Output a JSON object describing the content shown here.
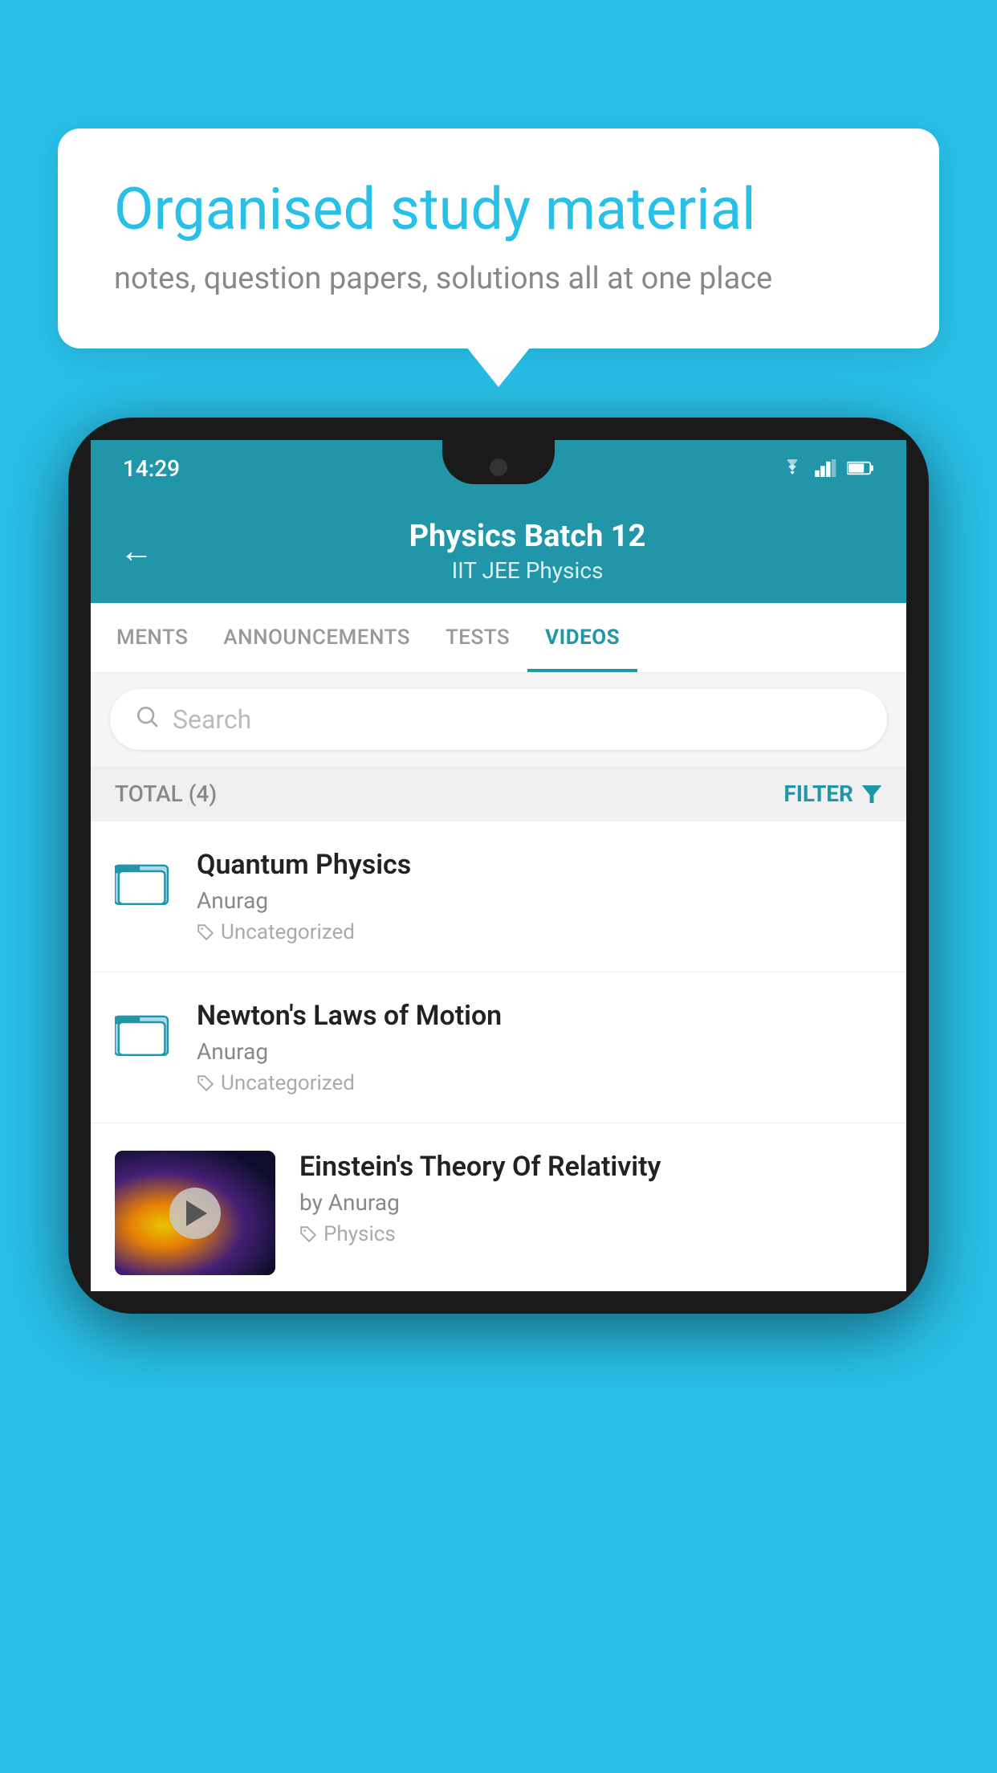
{
  "background_color": "#29C0E8",
  "bubble": {
    "title": "Organised study material",
    "subtitle": "notes, question papers, solutions all at one place"
  },
  "phone": {
    "status_bar": {
      "time": "14:29",
      "icons": [
        "wifi",
        "signal",
        "battery"
      ]
    },
    "header": {
      "back_label": "←",
      "title": "Physics Batch 12",
      "subtitle": "IIT JEE   Physics"
    },
    "tabs": [
      {
        "label": "MENTS",
        "active": false
      },
      {
        "label": "ANNOUNCEMENTS",
        "active": false
      },
      {
        "label": "TESTS",
        "active": false
      },
      {
        "label": "VIDEOS",
        "active": true
      }
    ],
    "search": {
      "placeholder": "Search"
    },
    "filter_bar": {
      "total_label": "TOTAL (4)",
      "filter_label": "FILTER"
    },
    "video_items": [
      {
        "id": 1,
        "title": "Quantum Physics",
        "author": "Anurag",
        "tag": "Uncategorized",
        "has_thumb": false
      },
      {
        "id": 2,
        "title": "Newton's Laws of Motion",
        "author": "Anurag",
        "tag": "Uncategorized",
        "has_thumb": false
      },
      {
        "id": 3,
        "title": "Einstein's Theory Of Relativity",
        "author": "by Anurag",
        "tag": "Physics",
        "has_thumb": true
      }
    ]
  }
}
